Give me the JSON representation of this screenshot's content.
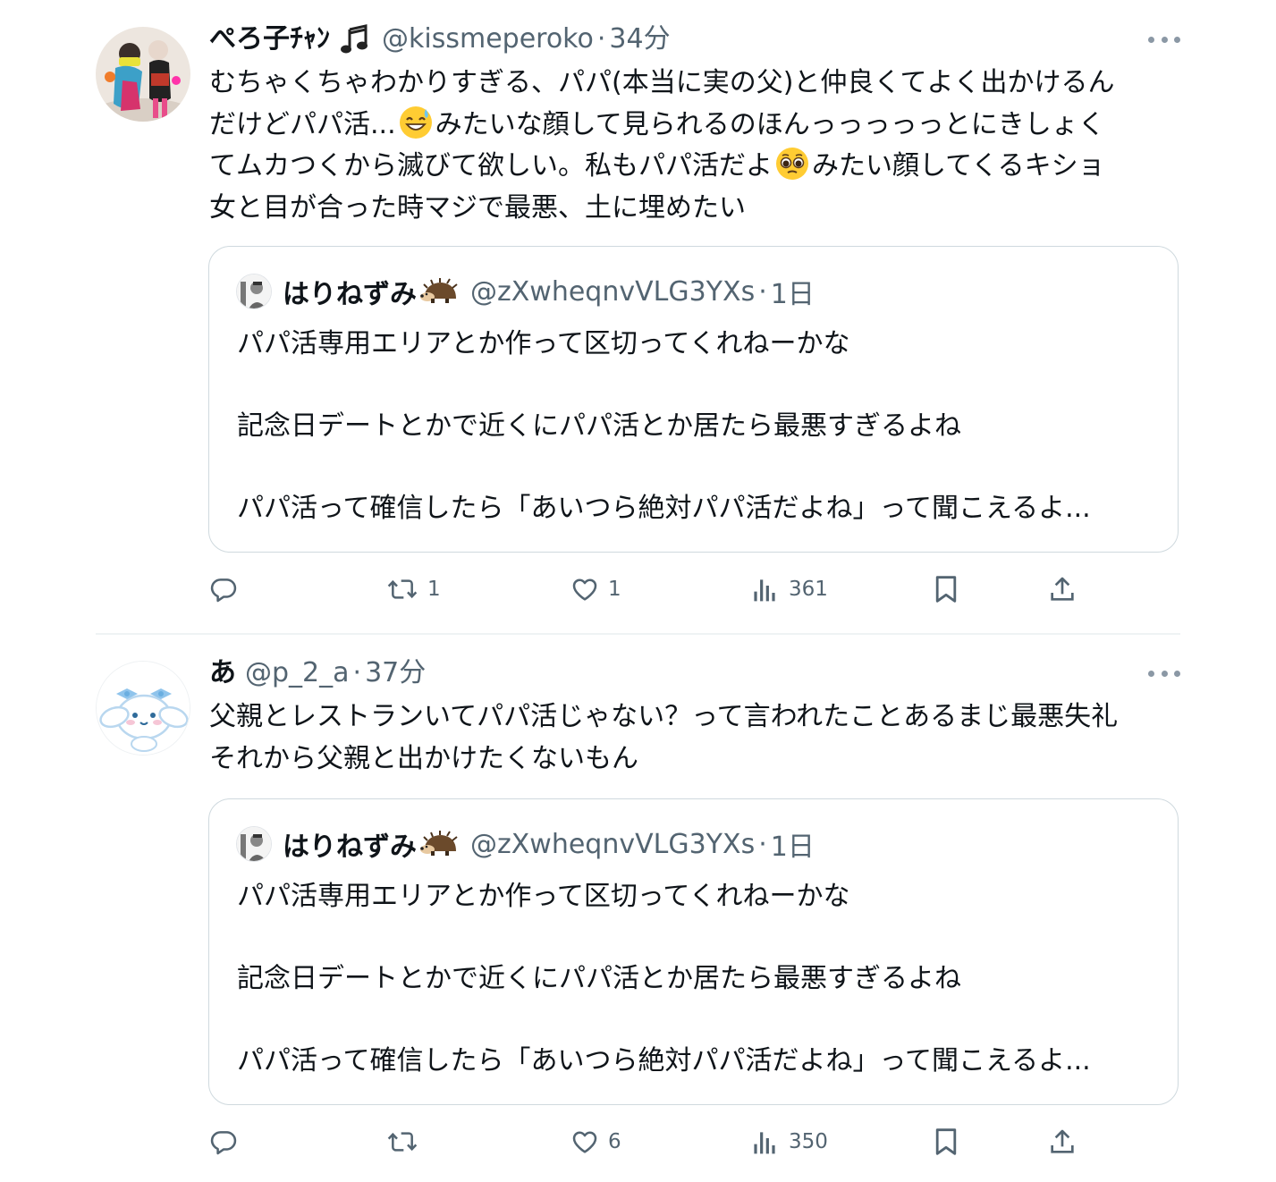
{
  "tweets": [
    {
      "display_name": "ぺろ子ﾁｬﾝ",
      "handle": "@kissmeperoko",
      "separator": "·",
      "time": "34分",
      "body_lines": [
        {
          "before": "むちゃくちゃわかりすぎる、パパ(本当に実の父)と仲良くてよく出かけるん",
          "after": ""
        },
        {
          "before": "だけどパパ活...",
          "after": "みたいな顔して見られるのほんっっっっっとにきしょく",
          "emoji": "grinning-sweat-emoji"
        },
        {
          "before": "てムカつくから滅びて欲しい。私もパパ活だよ",
          "after": "みたい顔してくるキショ",
          "emoji": "pleading-face-emoji"
        },
        {
          "before": "女と目が合った時マジで最悪、土に埋めたい",
          "after": ""
        }
      ],
      "quote": {
        "display_name": "はりねずみ",
        "handle": "@zXwheqnvVLG3YXs",
        "separator": "·",
        "time": "1日",
        "lines": [
          "パパ活専用エリアとか作って区切ってくれねーかな",
          "記念日デートとかで近くにパパ活とか居たら最悪すぎるよね",
          "パパ活って確信したら「あいつら絶対パパ活だよね」って聞こえるよ..."
        ]
      },
      "actions": {
        "reply_count": "",
        "retweet_count": "1",
        "like_count": "1",
        "views_count": "361"
      }
    },
    {
      "display_name": "あ",
      "handle": "@p_2_a",
      "separator": "·",
      "time": "37分",
      "body_lines": [
        {
          "before": "父親とレストランいてパパ活じゃない？って言われたことあるまじ最悪失礼",
          "after": ""
        },
        {
          "before": "それから父親と出かけたくないもん",
          "after": ""
        }
      ],
      "quote": {
        "display_name": "はりねずみ",
        "handle": "@zXwheqnvVLG3YXs",
        "separator": "·",
        "time": "1日",
        "lines": [
          "パパ活専用エリアとか作って区切ってくれねーかな",
          "記念日デートとかで近くにパパ活とか居たら最悪すぎるよね",
          "パパ活って確信したら「あいつら絶対パパ活だよね」って聞こえるよ..."
        ]
      },
      "actions": {
        "reply_count": "",
        "retweet_count": "",
        "like_count": "6",
        "views_count": "350"
      }
    }
  ],
  "colors": {
    "text_primary": "#0f1419",
    "text_secondary": "#536471",
    "border": "#cfd9de",
    "divider": "#eff3f4"
  },
  "icons": [
    "more-icon",
    "reply-icon",
    "retweet-icon",
    "like-icon",
    "views-icon",
    "bookmark-icon",
    "share-icon",
    "music-note-icon",
    "hedgehog-icon"
  ]
}
